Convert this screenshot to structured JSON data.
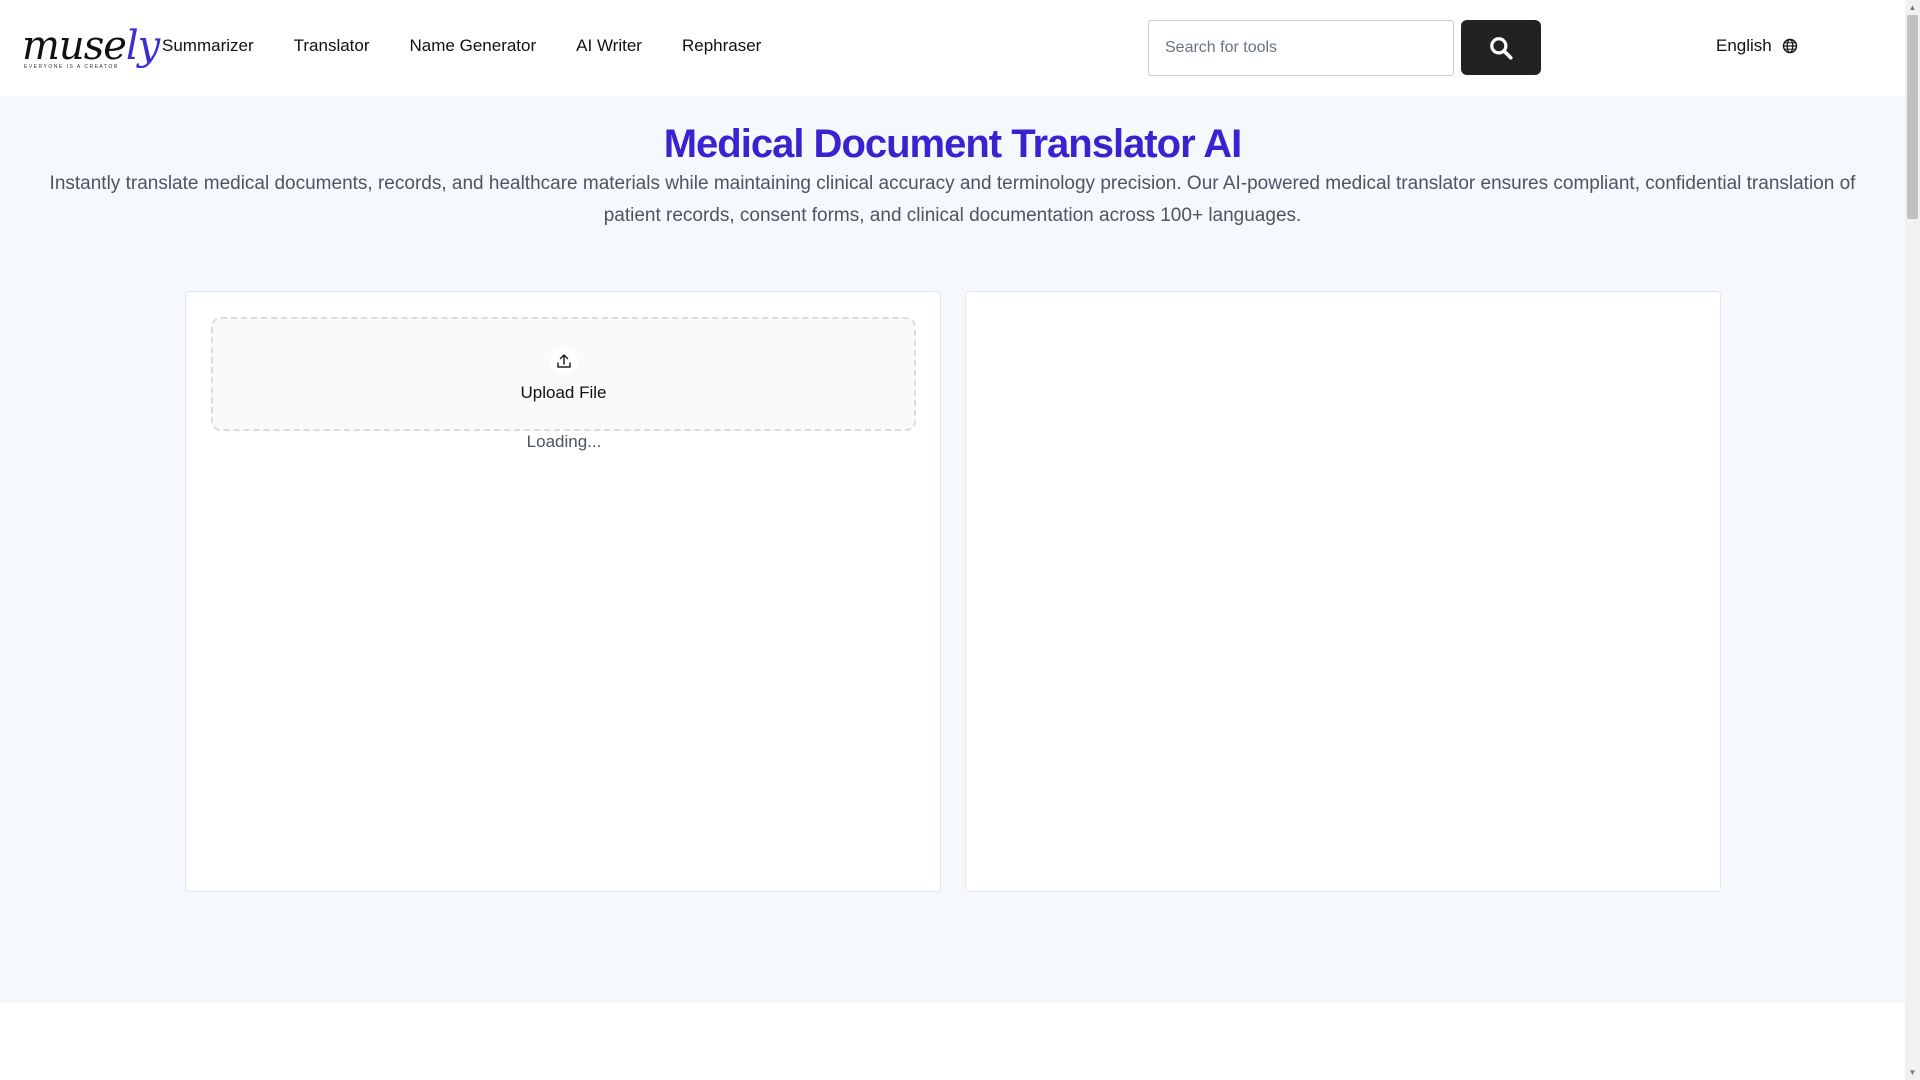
{
  "brand": {
    "logo_text": "muse",
    "logo_text_accent": "ly",
    "logo_tagline": "EVERYONE IS A CREATOR",
    "accent_color": "#3b22d1"
  },
  "nav": {
    "items": [
      {
        "label": "Summarizer"
      },
      {
        "label": "Translator"
      },
      {
        "label": "Name Generator"
      },
      {
        "label": "AI Writer"
      },
      {
        "label": "Rephraser"
      }
    ]
  },
  "search": {
    "placeholder": "Search for tools",
    "value": "",
    "button_icon": "search-icon"
  },
  "language": {
    "label": "English",
    "icon": "globe-icon"
  },
  "hero": {
    "title": "Medical Document Translator AI",
    "description": "Instantly translate medical documents, records, and healthcare materials while maintaining clinical accuracy and terminology precision. Our AI-powered medical translator ensures compliant, confidential translation of patient records, consent forms, and clinical documentation across 100+ languages."
  },
  "input_panel": {
    "upload_label": "Upload File",
    "upload_icon": "upload-icon",
    "status": "Loading..."
  },
  "output_panel": {}
}
